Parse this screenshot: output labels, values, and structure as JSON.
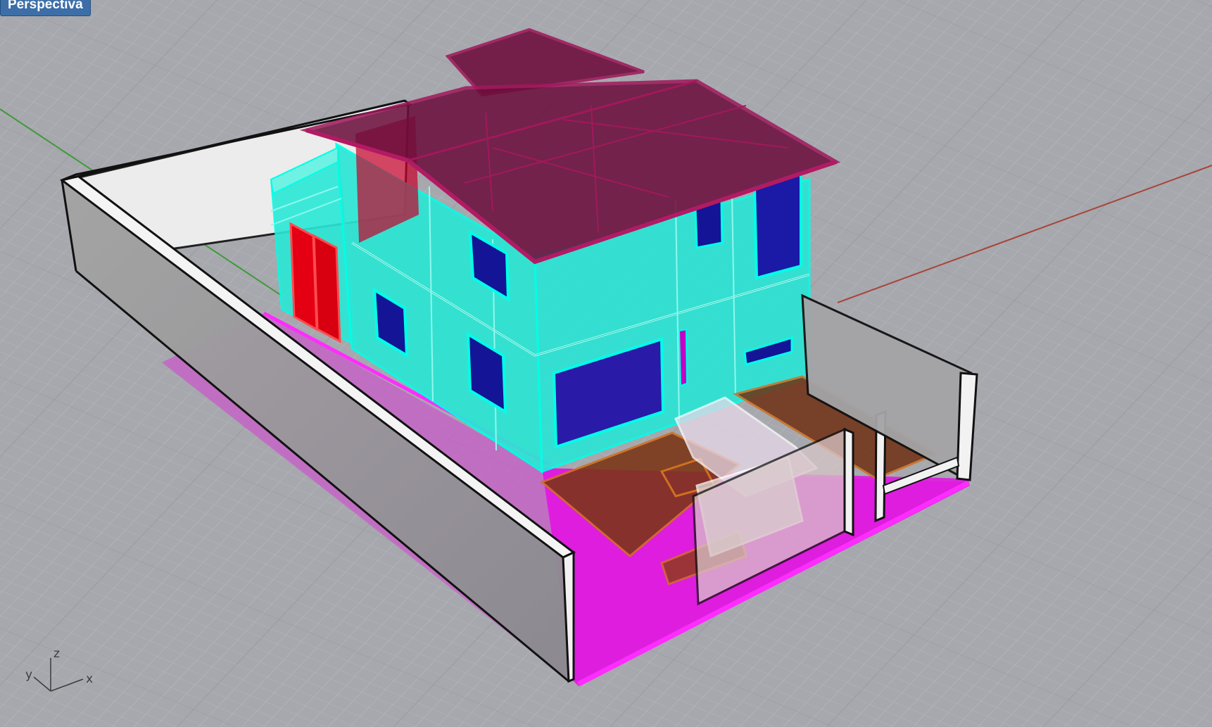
{
  "viewport": {
    "label": "Perspectiva"
  },
  "axis_widget": {
    "x": "x",
    "y": "y",
    "z": "z"
  },
  "colors": {
    "background": "#a6a8ad",
    "grid_minor": "#b7b9bd",
    "grid_major": "#8f9196",
    "x_axis": "#a8453a",
    "y_axis": "#3f9a3a",
    "walls_cyan": "#00f0d8",
    "roof": "#7a0c3c",
    "slab_magenta": "#ea00ea",
    "windows": "#1e1aa0",
    "doors": "#e00010",
    "furniture": "#8a3a10",
    "fence": "#b8b8b8",
    "label_bg": "#3d6ea8"
  }
}
